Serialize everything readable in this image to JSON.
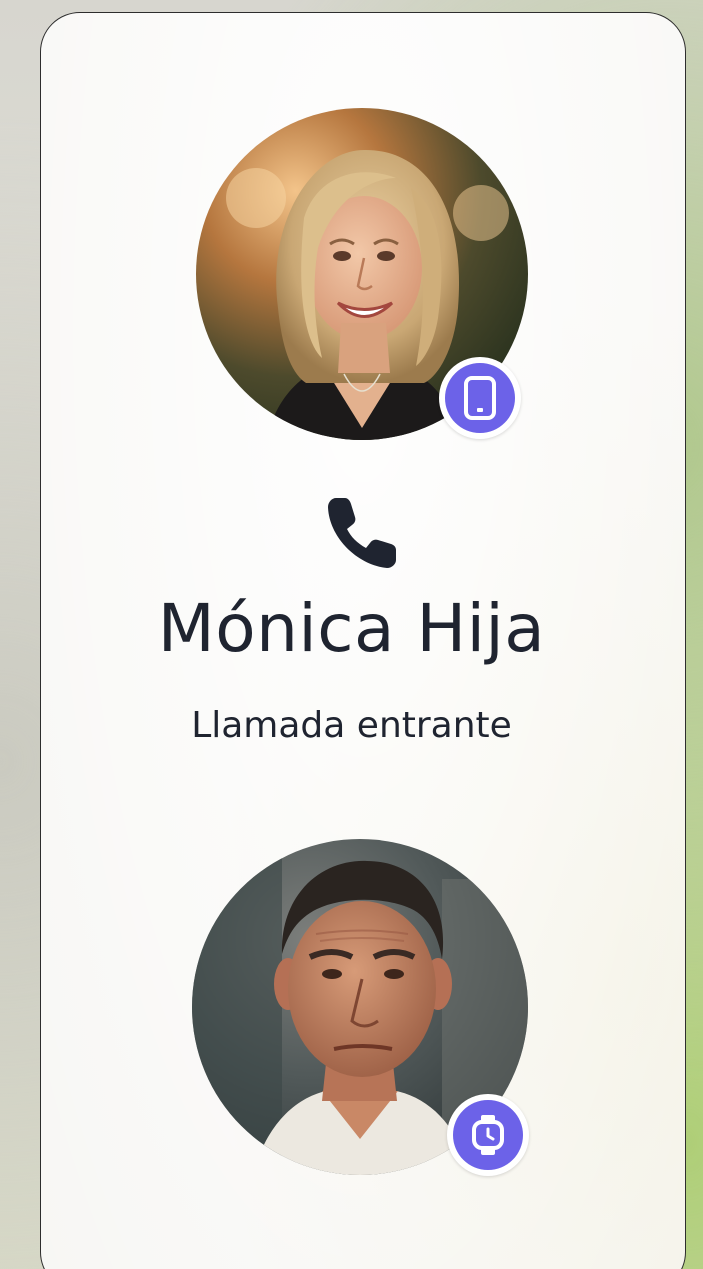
{
  "call": {
    "caller_name": "Mónica Hija",
    "status": "Llamada entrante"
  },
  "caller": {
    "avatar": "caller-photo-woman",
    "device_icon": "smartphone-icon"
  },
  "receiver": {
    "avatar": "receiver-photo-man",
    "device_icon": "smartwatch-icon"
  },
  "icons": {
    "call": "phone-handset-icon"
  },
  "colors": {
    "badge": "#6c62e8",
    "text": "#1f2430"
  }
}
